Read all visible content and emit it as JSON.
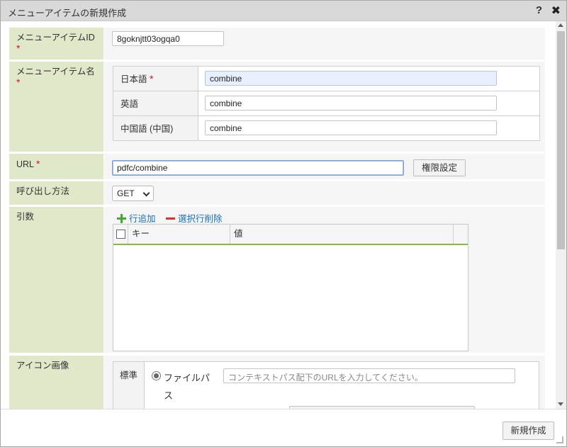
{
  "dialog": {
    "title": "メニューアイテムの新規作成",
    "help": "?",
    "close": "✖"
  },
  "required_mark": "*",
  "fields": {
    "id": {
      "label": "メニューアイテムID",
      "value": "8goknjtt03ogqa0"
    },
    "name": {
      "label": "メニューアイテム名",
      "langs": [
        {
          "label": "日本語",
          "required": true,
          "value": "combine"
        },
        {
          "label": "英語",
          "required": false,
          "value": "combine"
        },
        {
          "label": "中国語 (中国)",
          "required": false,
          "value": "combine"
        }
      ]
    },
    "url": {
      "label": "URL",
      "value": "pdfc/combine",
      "auth_button": "権限設定"
    },
    "method": {
      "label": "呼び出し方法",
      "value": "GET"
    },
    "args": {
      "label": "引数",
      "add_label": "行追加",
      "delete_label": "選択行削除",
      "columns": [
        "キー",
        "値"
      ]
    },
    "icon": {
      "label": "アイコン画像",
      "standard_label": "標準",
      "file_path_label": "ファイルパス",
      "file_path_placeholder": "コンテキストパス配下のURLを入力してください。"
    }
  },
  "footer": {
    "create_button": "新規作成"
  },
  "colors": {
    "label_bg": "#dfe9c9",
    "required": "#e0102c",
    "link": "#1a6fc2",
    "grid_accent": "#86b84a"
  }
}
